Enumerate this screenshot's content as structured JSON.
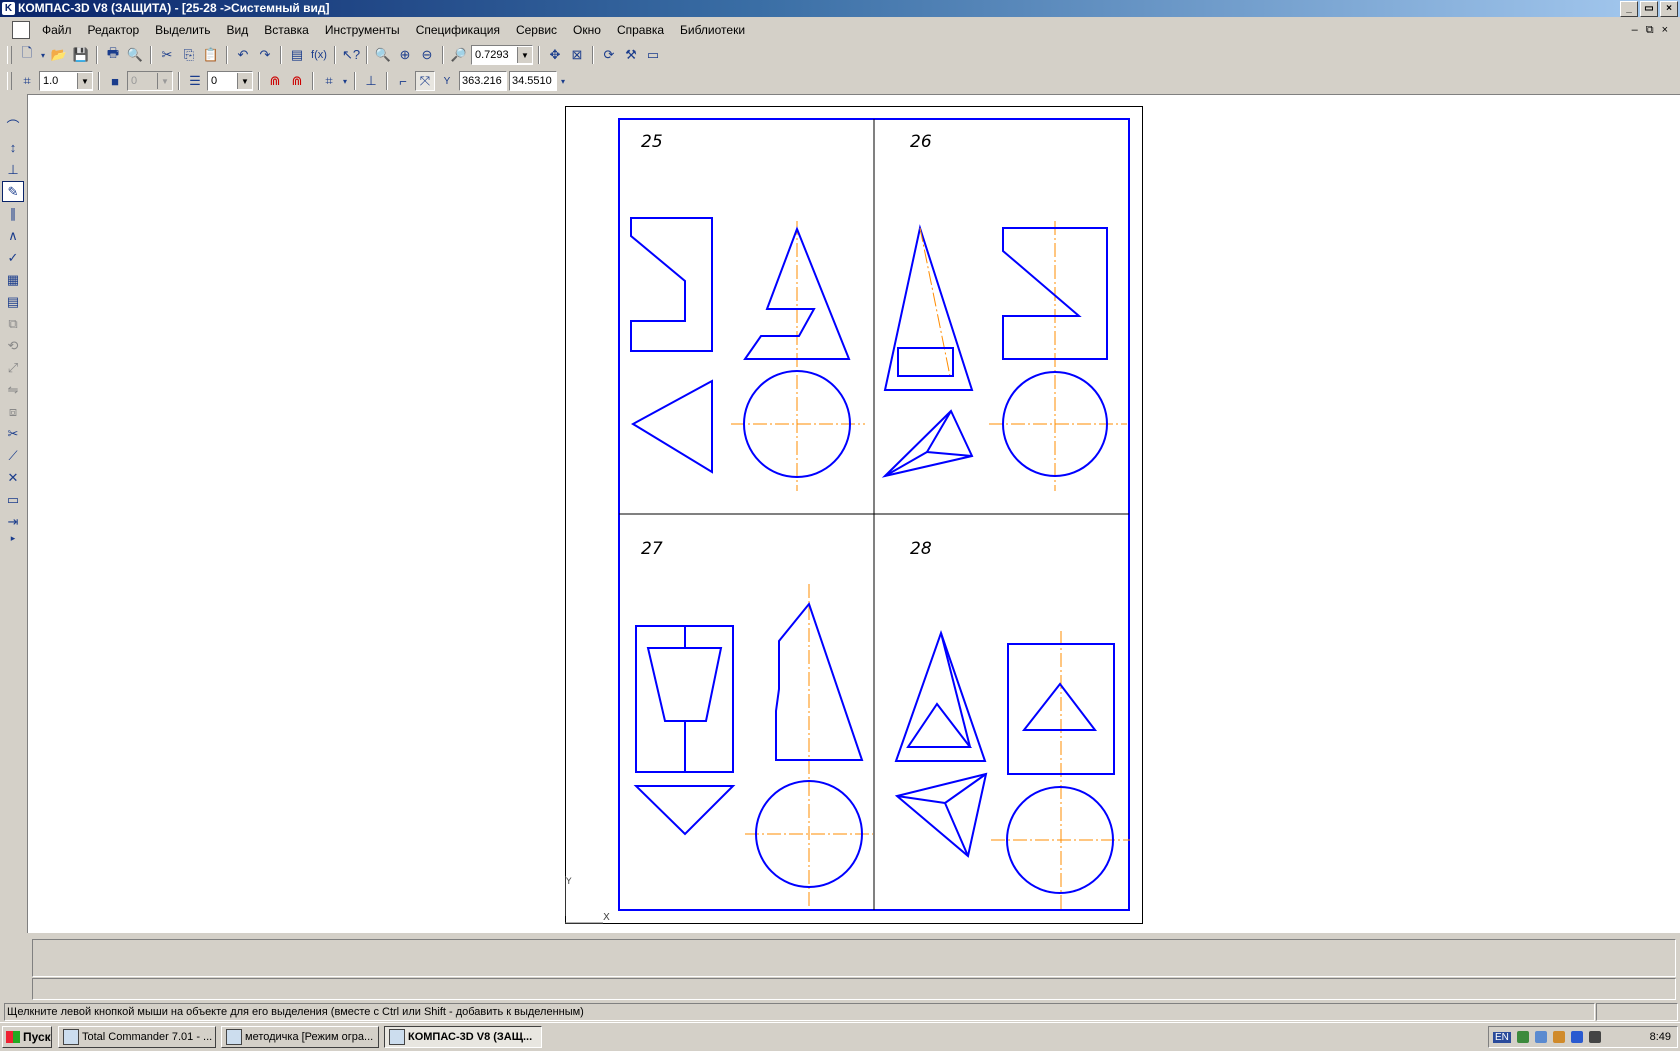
{
  "window": {
    "title": "КОМПАС-3D V8 (ЗАЩИТА) - [25-28 ->Системный вид]",
    "controls": [
      "_",
      "▭",
      "×"
    ]
  },
  "menu": {
    "items": [
      "Файл",
      "Редактор",
      "Выделить",
      "Вид",
      "Вставка",
      "Инструменты",
      "Спецификация",
      "Сервис",
      "Окно",
      "Справка",
      "Библиотеки"
    ],
    "mdi_controls": [
      "‒",
      "⧉",
      "×"
    ]
  },
  "toolbar1": {
    "zoom_value": "0.7293"
  },
  "toolbar2": {
    "scale_value": "1.0",
    "style_value": "0",
    "layer_value": "0",
    "coord_y_label": "Y",
    "coord_x_value": "363.216",
    "coord_y_value": "34.5510"
  },
  "drawing": {
    "labels": [
      "25",
      "26",
      "27",
      "28"
    ],
    "colors": {
      "outline": "#0000ff",
      "axis": "#ff8c00",
      "border": "#000000"
    }
  },
  "status": {
    "hint": "Щелкните левой кнопкой мыши на объекте для его выделения (вместе с Ctrl или Shift - добавить к выделенным)"
  },
  "taskbar": {
    "start_label": "Пуск",
    "tasks": [
      "Total Commander 7.01 - ...",
      "методичка [Режим огра...",
      "КОМПАС-3D V8 (ЗАЩ..."
    ],
    "lang": "EN",
    "clock": "8:49"
  }
}
